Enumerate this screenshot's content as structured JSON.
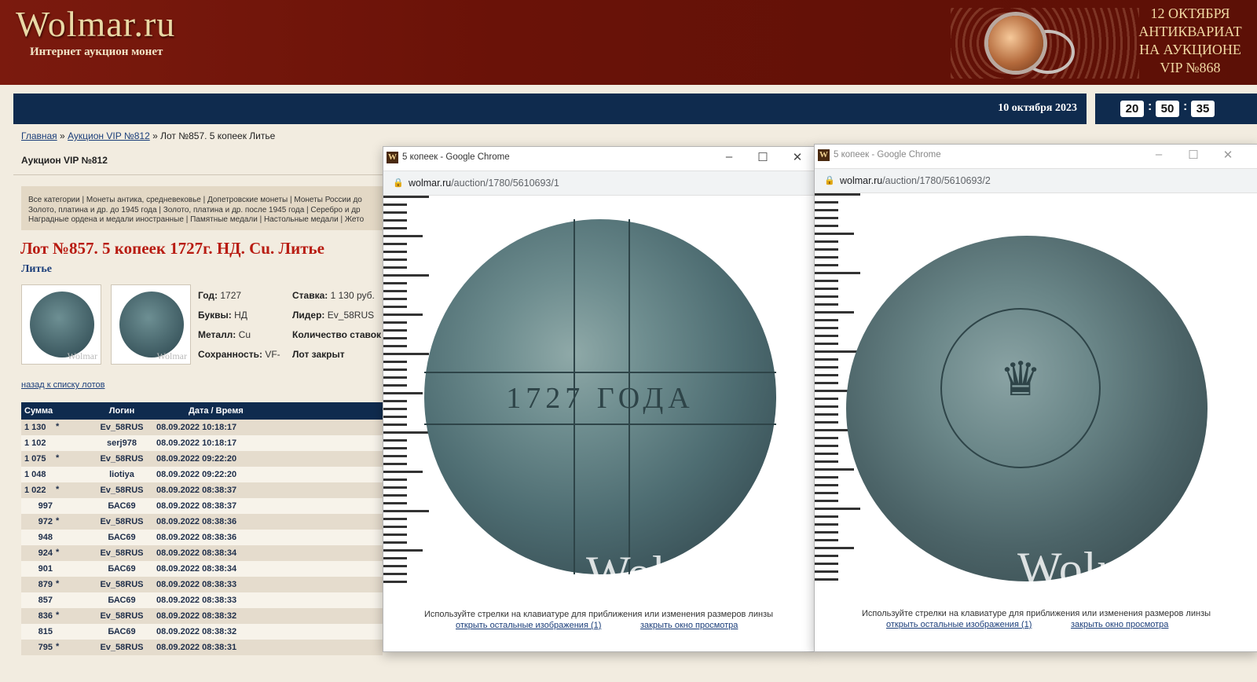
{
  "header": {
    "logo": "Wolmar.ru",
    "tagline": "Интернет аукцион монет",
    "promo": [
      "12 ОКТЯБРЯ",
      "АНТИКВАРИАТ",
      "НА АУКЦИОНЕ",
      "VIP №868"
    ]
  },
  "nav": {
    "date": "10 октября 2023",
    "clock": {
      "h": "20",
      "m": "50",
      "s": "35"
    }
  },
  "breadcrumb": {
    "home": "Главная",
    "auction": "Аукцион VIP №812",
    "current": "» Лот №857. 5 копеек Литье"
  },
  "auction_title": "Аукцион VIP №812",
  "categories": [
    "Все категории | Монеты антика, средневековье | Допетровские монеты | Монеты России до",
    "Золото, платина и др. до 1945 года | Золото, платина и др. после 1945 года | Серебро и др",
    "Наградные ордена и медали иностранные | Памятные медали | Настольные медали | Жето"
  ],
  "lot": {
    "title": "Лот №857.  5 копеек 1727г. НД. Cu. Литье",
    "subtitle": "Литье",
    "thumb_watermark": "Wolmar",
    "year_label": "Год:",
    "year": "1727",
    "letters_label": "Буквы:",
    "letters": "НД",
    "metal_label": "Металл:",
    "metal": "Cu",
    "grade_label": "Сохранность:",
    "grade": "VF-",
    "bid_label": "Ставка:",
    "bid": "1 130 руб.",
    "leader_label": "Лидер:",
    "leader": "Ev_58RUS",
    "count_label": "Количество ставок",
    "status": "Лот закрыт"
  },
  "back_link": "назад к списку лотов",
  "bids": {
    "headers": [
      "Сумма",
      "Логин",
      "Дата / Время"
    ],
    "rows": [
      {
        "sum": "1 130",
        "star": "*",
        "login": "Ev_58RUS",
        "time": "08.09.2022 10:18:17"
      },
      {
        "sum": "1 102",
        "star": "",
        "login": "serj978",
        "time": "08.09.2022 10:18:17"
      },
      {
        "sum": "1 075",
        "star": "*",
        "login": "Ev_58RUS",
        "time": "08.09.2022 09:22:20"
      },
      {
        "sum": "1 048",
        "star": "",
        "login": "liotiya",
        "time": "08.09.2022 09:22:20"
      },
      {
        "sum": "1 022",
        "star": "*",
        "login": "Ev_58RUS",
        "time": "08.09.2022 08:38:37"
      },
      {
        "sum": "997",
        "star": "",
        "login": "БАС69",
        "time": "08.09.2022 08:38:37"
      },
      {
        "sum": "972",
        "star": "*",
        "login": "Ev_58RUS",
        "time": "08.09.2022 08:38:36"
      },
      {
        "sum": "948",
        "star": "",
        "login": "БАС69",
        "time": "08.09.2022 08:38:36"
      },
      {
        "sum": "924",
        "star": "*",
        "login": "Ev_58RUS",
        "time": "08.09.2022 08:38:34"
      },
      {
        "sum": "901",
        "star": "",
        "login": "БАС69",
        "time": "08.09.2022 08:38:34"
      },
      {
        "sum": "879",
        "star": "*",
        "login": "Ev_58RUS",
        "time": "08.09.2022 08:38:33"
      },
      {
        "sum": "857",
        "star": "",
        "login": "БАС69",
        "time": "08.09.2022 08:38:33"
      },
      {
        "sum": "836",
        "star": "*",
        "login": "Ev_58RUS",
        "time": "08.09.2022 08:38:32"
      },
      {
        "sum": "815",
        "star": "",
        "login": "БАС69",
        "time": "08.09.2022 08:38:32"
      },
      {
        "sum": "795",
        "star": "*",
        "login": "Ev_58RUS",
        "time": "08.09.2022 08:38:31"
      }
    ]
  },
  "popups": [
    {
      "title": "5 копеек - Google Chrome",
      "url_domain": "wolmar.ru",
      "url_path": "/auction/1780/5610693/1",
      "coin_text": "1727 ГОДА",
      "watermark": "Wolmar",
      "hint": "Используйте стрелки на клавиатуре для приближения или изменения размеров линзы",
      "link_more": "открыть остальные изображения (1)",
      "link_close": "закрыть окно просмотра"
    },
    {
      "title": "5 копеек - Google Chrome",
      "url_domain": "wolmar.ru",
      "url_path": "/auction/1780/5610693/2",
      "watermark": "Wolmar",
      "hint": "Используйте стрелки на клавиатуре для приближения или изменения размеров линзы",
      "link_more": "открыть остальные изображения (1)",
      "link_close": "закрыть окно просмотра"
    }
  ],
  "colors": {
    "header_bg": "#6a1208",
    "nav_bg": "#0f2b4e",
    "lot_title": "#b81c12",
    "link": "#1b3e7a"
  }
}
